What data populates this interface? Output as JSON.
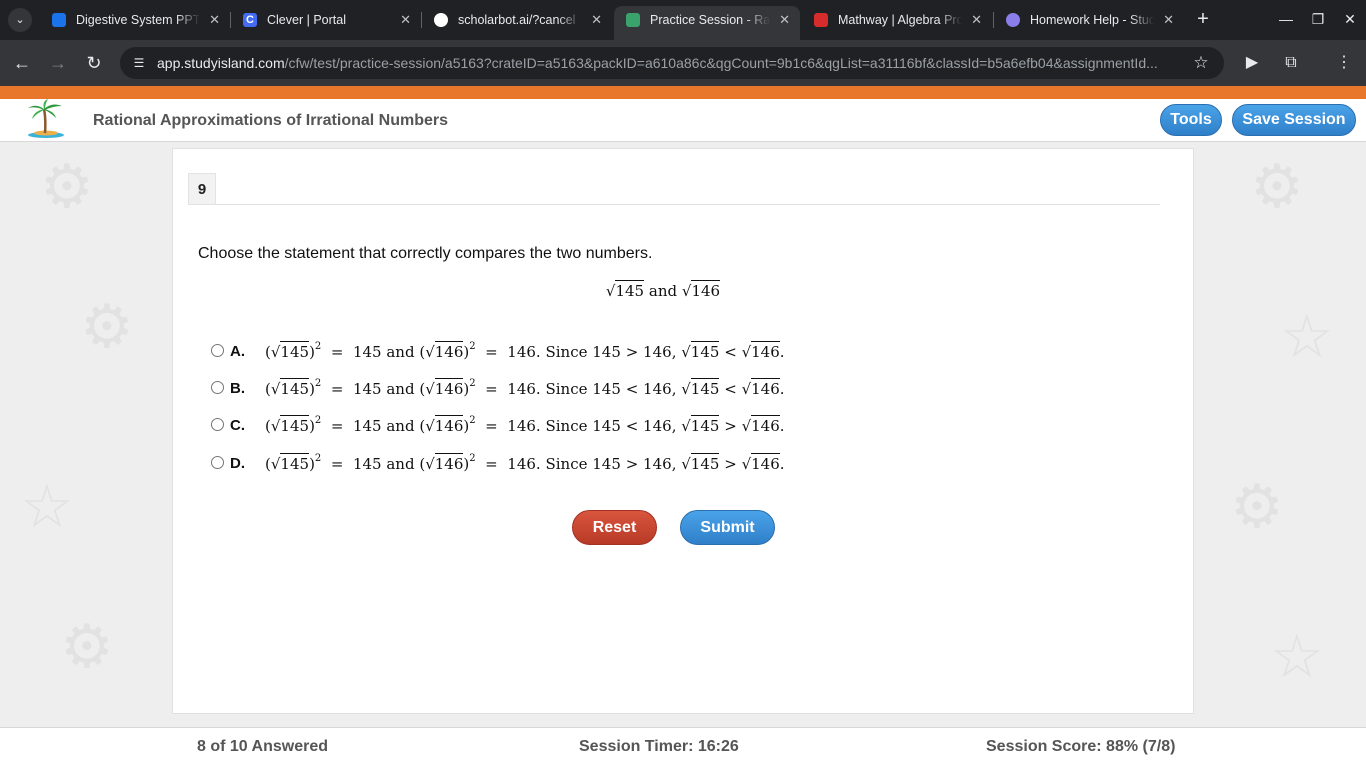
{
  "browser": {
    "tabs": [
      {
        "title": "Digestive System PPT",
        "active": false,
        "icon": "google-classroom-icon"
      },
      {
        "title": "Clever | Portal",
        "active": false,
        "icon": "clever-icon"
      },
      {
        "title": "scholarbot.ai/?cancel",
        "active": false,
        "icon": "scholarbot-icon"
      },
      {
        "title": "Practice Session - Rati",
        "active": true,
        "icon": "studyisland-icon"
      },
      {
        "title": "Mathway | Algebra Pro",
        "active": false,
        "icon": "mathway-icon"
      },
      {
        "title": "Homework Help - Stud",
        "active": false,
        "icon": "homework-help-icon"
      }
    ],
    "url_host": "app.studyisland.com",
    "url_path": "/cfw/test/practice-session/a5163?crateID=a5163&packID=a610a86c&qgCount=9b1c6&qgList=a31116bf&classId=b5a6efb04&assignmentId..."
  },
  "header": {
    "title": "Rational Approximations of Irrational Numbers",
    "tools_label": "Tools",
    "save_label": "Save Session"
  },
  "question": {
    "number": "9",
    "prompt": "Choose the statement that correctly compares the two numbers.",
    "expression": {
      "a": "145",
      "b": "146",
      "joiner": "and"
    },
    "options": [
      {
        "letter": "A.",
        "cmp1": ">",
        "cmp2": "<"
      },
      {
        "letter": "B.",
        "cmp1": "<",
        "cmp2": "<"
      },
      {
        "letter": "C.",
        "cmp1": "<",
        "cmp2": ">"
      },
      {
        "letter": "D.",
        "cmp1": ">",
        "cmp2": ">"
      }
    ],
    "option_text": {
      "n1": "145",
      "n2": "146",
      "exponent": "2",
      "and": "and",
      "since": "Since"
    }
  },
  "buttons": {
    "reset": "Reset",
    "submit": "Submit"
  },
  "status": {
    "answered": "8 of 10 Answered",
    "timer": "Session Timer: 16:26",
    "score": "Session Score: 88% (7/8)"
  },
  "colors": {
    "accent_orange": "#e8762b",
    "button_blue": "#3a8fd9",
    "button_red": "#c8452f"
  }
}
